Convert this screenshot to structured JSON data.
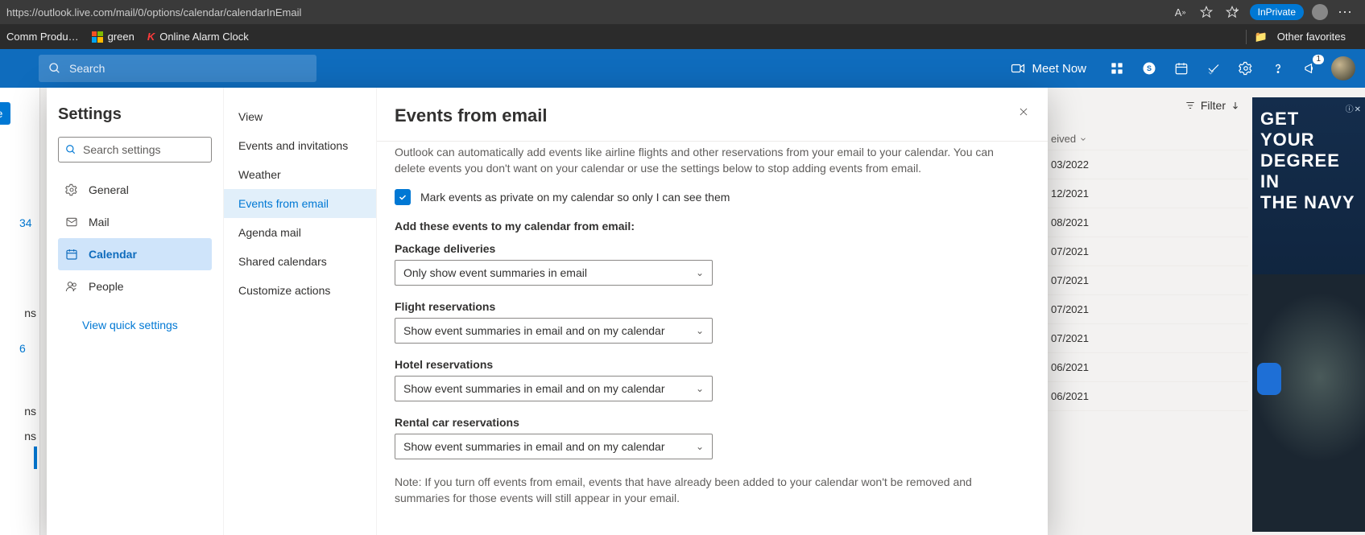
{
  "browser": {
    "url": "https://outlook.live.com/mail/0/options/calendar/calendarInEmail",
    "inprivate": "InPrivate",
    "other_favorites": "Other favorites"
  },
  "bookmarks": {
    "items": [
      {
        "label": "Comm Produ…"
      },
      {
        "label": "green"
      },
      {
        "label": "Online Alarm Clock"
      }
    ]
  },
  "header": {
    "search_placeholder": "Search",
    "meet_now": "Meet Now",
    "megaphone_badge": "1"
  },
  "background": {
    "left_button_frag": "age",
    "num_34": "34",
    "num_6": "6",
    "txt_ns": "ns",
    "filter": "Filter",
    "received": "eived",
    "dates": [
      "03/2022",
      "12/2021",
      "08/2021",
      "07/2021",
      "07/2021",
      "07/2021",
      "07/2021",
      "06/2021",
      "06/2021"
    ]
  },
  "ad": {
    "line1": "GET YOUR",
    "line2": "DEGREE IN",
    "line3": "THE NAVY"
  },
  "settings": {
    "title": "Settings",
    "search_placeholder": "Search settings",
    "nav": [
      {
        "label": "General"
      },
      {
        "label": "Mail"
      },
      {
        "label": "Calendar"
      },
      {
        "label": "People"
      }
    ],
    "quick": "View quick settings",
    "sub": [
      {
        "label": "View"
      },
      {
        "label": "Events and invitations"
      },
      {
        "label": "Weather"
      },
      {
        "label": "Events from email"
      },
      {
        "label": "Agenda mail"
      },
      {
        "label": "Shared calendars"
      },
      {
        "label": "Customize actions"
      }
    ]
  },
  "panel": {
    "heading": "Events from email",
    "description": "Outlook can automatically add events like airline flights and other reservations from your email to your calendar. You can delete events you don't want on your calendar or use the settings below to stop adding events from email.",
    "checkbox_label": "Mark events as private on my calendar so only I can see them",
    "add_heading": "Add these events to my calendar from email:",
    "fields": [
      {
        "label": "Package deliveries",
        "value": "Only show event summaries in email"
      },
      {
        "label": "Flight reservations",
        "value": "Show event summaries in email and on my calendar"
      },
      {
        "label": "Hotel reservations",
        "value": "Show event summaries in email and on my calendar"
      },
      {
        "label": "Rental car reservations",
        "value": "Show event summaries in email and on my calendar"
      }
    ],
    "note": "Note: If you turn off events from email, events that have already been added to your calendar won't be removed and summaries for those events will still appear in your email."
  }
}
